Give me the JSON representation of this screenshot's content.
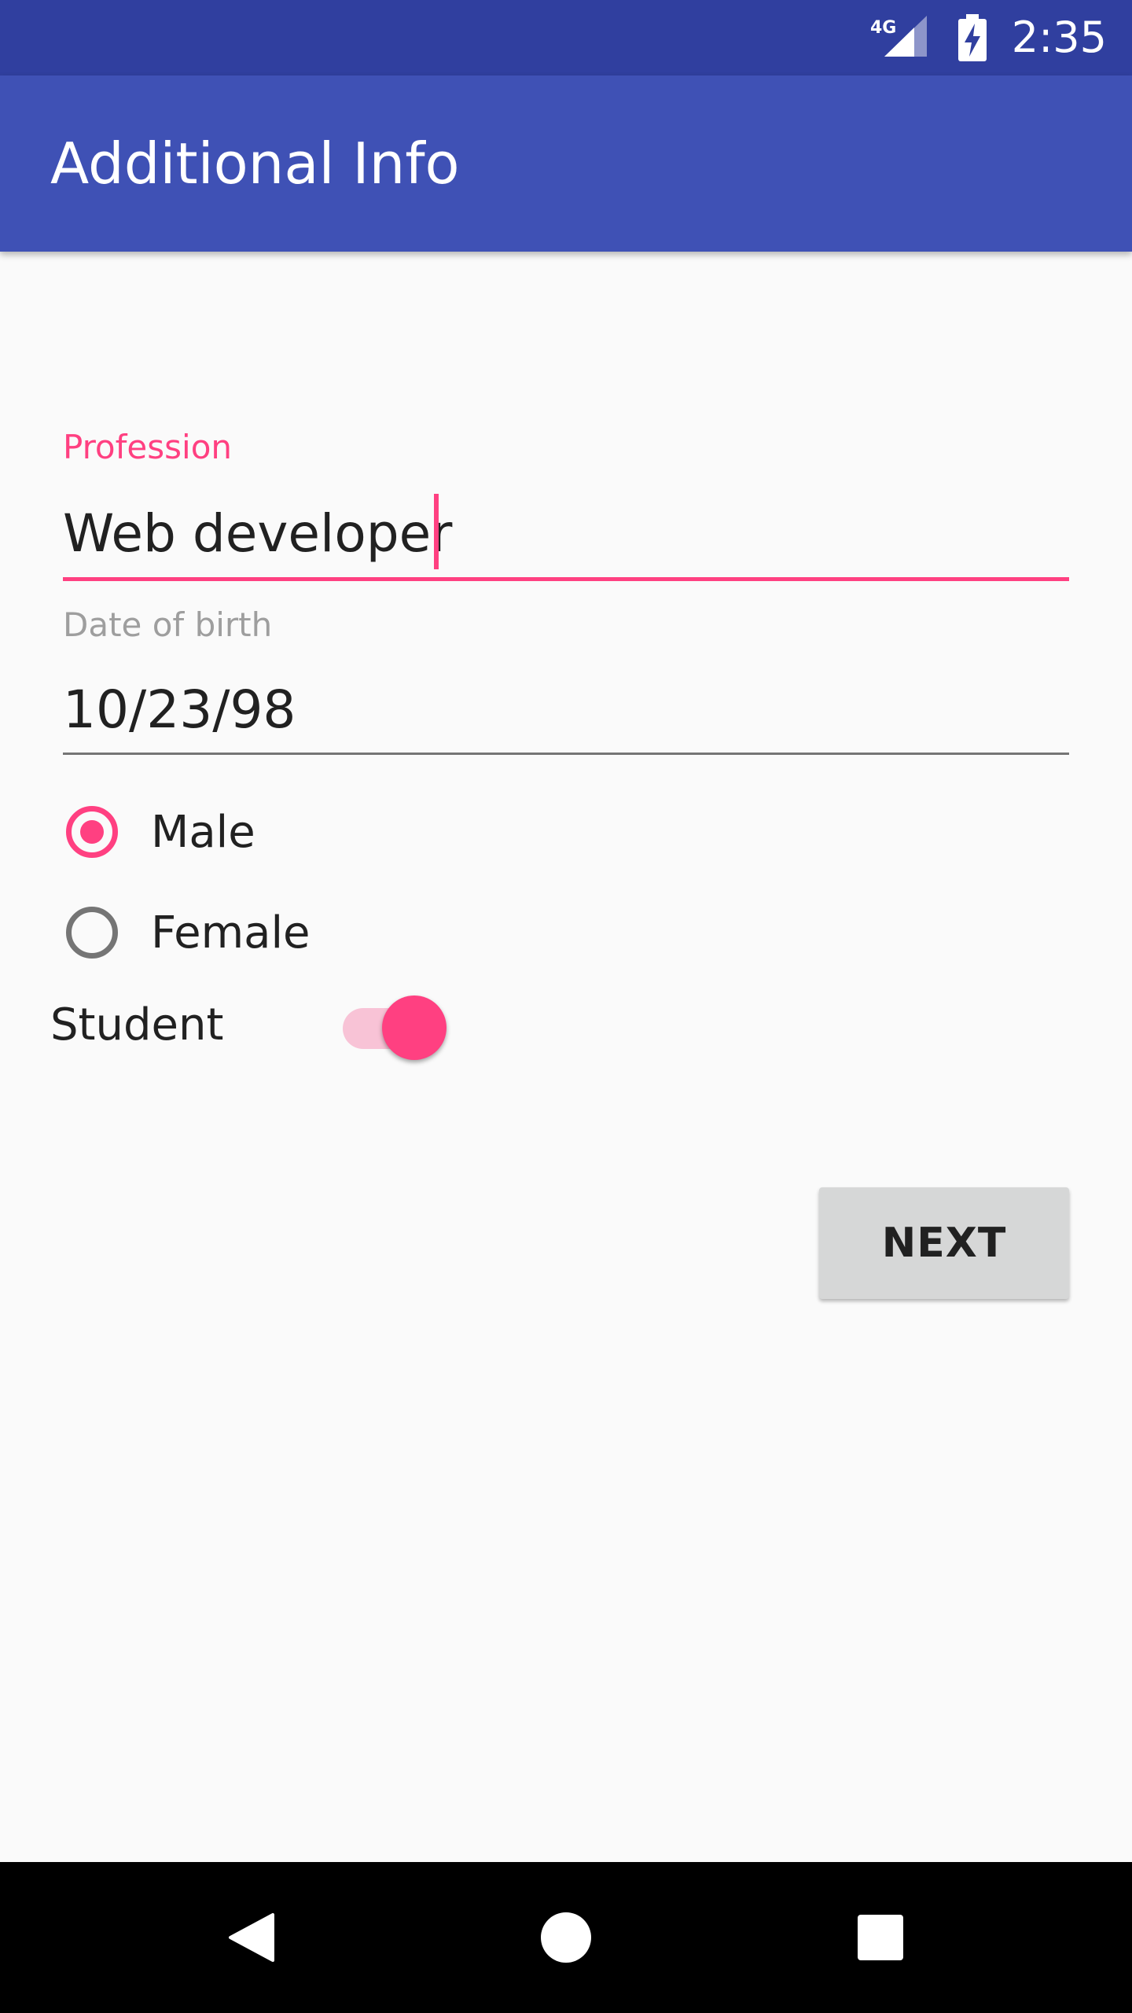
{
  "status_bar": {
    "network_label": "4G",
    "time": "2:35",
    "icons": [
      "signal-icon",
      "battery-charging-icon"
    ]
  },
  "app_bar": {
    "title": "Additional Info"
  },
  "form": {
    "profession": {
      "label": "Profession",
      "value": "Web developer",
      "focused": true
    },
    "date_of_birth": {
      "label": "Date of birth",
      "value": "10/23/98"
    },
    "gender": {
      "options": [
        {
          "label": "Male",
          "selected": true
        },
        {
          "label": "Female",
          "selected": false
        }
      ]
    },
    "student": {
      "label": "Student",
      "on": true
    },
    "next_button_label": "NEXT"
  },
  "nav_bar": {
    "icons": [
      "back-icon",
      "home-icon",
      "recents-icon"
    ]
  },
  "colors": {
    "primary": "#3f51b5",
    "primary_dark": "#303f9f",
    "accent": "#ff4081",
    "background": "#fafafa"
  }
}
